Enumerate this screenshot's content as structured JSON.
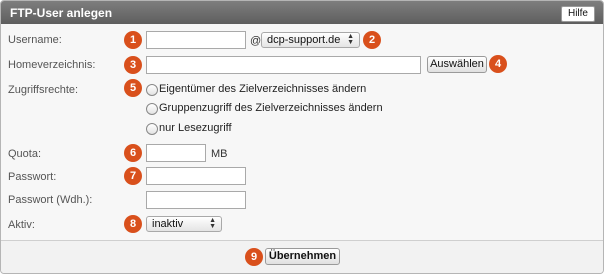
{
  "title": "FTP-User anlegen",
  "help_label": "Hilfe",
  "fields": {
    "username": {
      "label": "Username:",
      "value": "",
      "at": "@",
      "domain": "dcp-support.de"
    },
    "homedir": {
      "label": "Homeverzeichnis:",
      "value": "",
      "browse_label": "Auswählen"
    },
    "rights": {
      "label": "Zugriffsrechte:",
      "options": [
        "Eigentümer des Zielverzeichnisses ändern",
        "Gruppenzugriff des Zielverzeichnisses ändern",
        "nur Lesezugriff"
      ]
    },
    "quota": {
      "label": "Quota:",
      "value": "",
      "unit": "MB"
    },
    "password": {
      "label": "Passwort:",
      "value": ""
    },
    "password_repeat": {
      "label": "Passwort (Wdh.):",
      "value": ""
    },
    "active": {
      "label": "Aktiv:",
      "value": "inaktiv"
    }
  },
  "submit_label": "Übernehmen",
  "badges": [
    "1",
    "2",
    "3",
    "4",
    "5",
    "6",
    "7",
    "8",
    "9"
  ],
  "colors": {
    "badge": "#d9501c",
    "titlebar": "#6b6b6b"
  }
}
